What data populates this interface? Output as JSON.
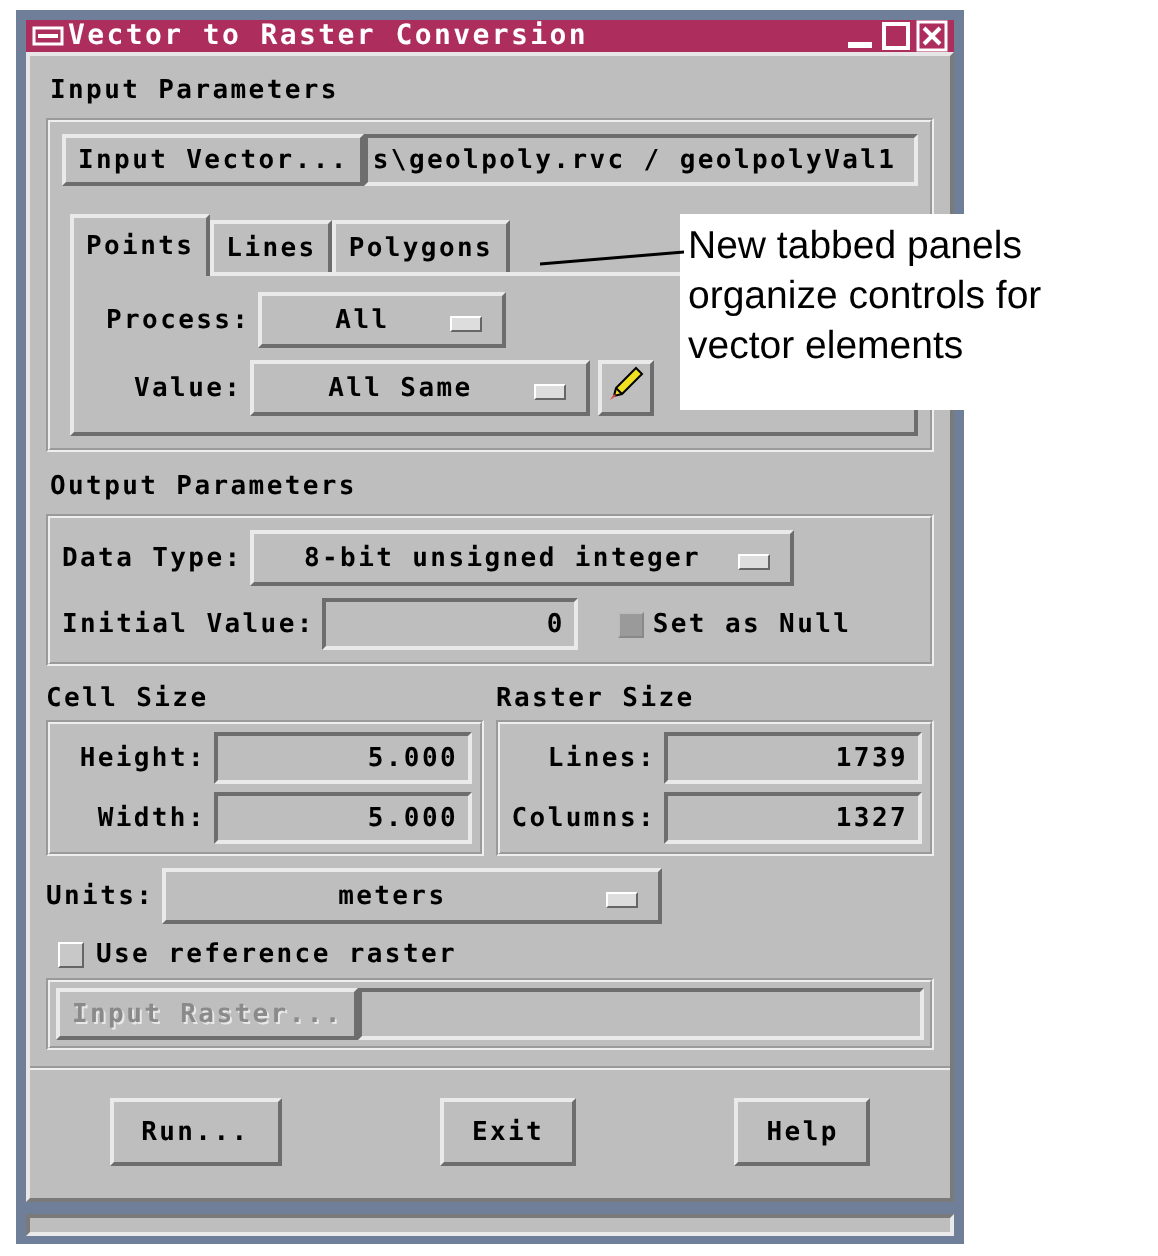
{
  "window": {
    "title": "Vector to Raster Conversion"
  },
  "input_parameters": {
    "heading": "Input Parameters",
    "input_vector": {
      "button": "Input Vector...",
      "value": "s\\geolpoly.rvc / geolpolyVal1"
    },
    "tabs": [
      {
        "label": "Points",
        "selected": true
      },
      {
        "label": "Lines",
        "selected": false
      },
      {
        "label": "Polygons",
        "selected": false
      }
    ],
    "process": {
      "label": "Process:",
      "value": "All"
    },
    "value": {
      "label": "Value:",
      "value": "All Same"
    }
  },
  "output_parameters": {
    "heading": "Output Parameters",
    "data_type": {
      "label": "Data Type:",
      "value": "8-bit unsigned integer"
    },
    "initial_value": {
      "label": "Initial Value:",
      "value": "0"
    },
    "set_as_null": {
      "label": "Set as Null",
      "checked": false,
      "disabled": true
    },
    "cell_size": {
      "heading": "Cell Size",
      "fields": [
        {
          "label": "Height:",
          "value": "5.000"
        },
        {
          "label": "Width:",
          "value": "5.000"
        }
      ]
    },
    "raster_size": {
      "heading": "Raster Size",
      "fields": [
        {
          "label": "Lines:",
          "value": "1739"
        },
        {
          "label": "Columns:",
          "value": "1327"
        }
      ]
    },
    "units": {
      "label": "Units:",
      "value": "meters"
    },
    "use_reference_raster": {
      "label": "Use reference raster",
      "checked": false,
      "disabled": false
    },
    "input_raster": {
      "button": "Input Raster...",
      "disabled": true
    }
  },
  "buttons": [
    "Run...",
    "Exit",
    "Help"
  ],
  "callout": {
    "text": "New tabbed panels organize controls for vector elements"
  }
}
